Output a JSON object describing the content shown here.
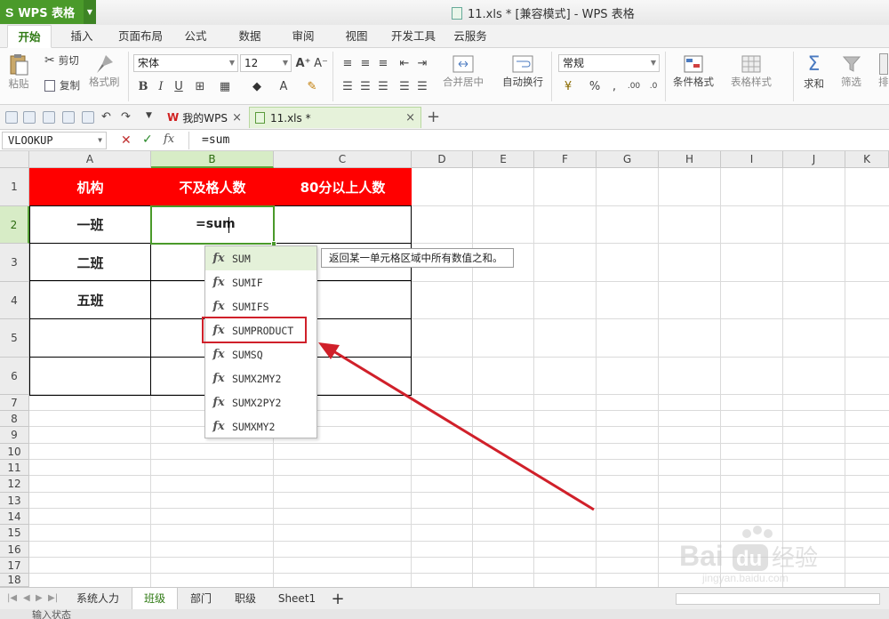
{
  "app": {
    "name": "WPS 表格",
    "window_title": "11.xls * [兼容模式] - WPS 表格"
  },
  "ribbon_tabs": [
    "开始",
    "插入",
    "页面布局",
    "公式",
    "数据",
    "审阅",
    "视图",
    "开发工具",
    "云服务"
  ],
  "ribbon": {
    "paste": "粘贴",
    "cut": "剪切",
    "copy": "复制",
    "format_painter": "格式刷",
    "font_name": "宋体",
    "font_size": "12",
    "bold": "B",
    "italic": "I",
    "underline": "U",
    "merge_center": "合并居中",
    "wrap_text": "自动换行",
    "number_format": "常规",
    "percent": "%",
    "cond_format": "条件格式",
    "table_style": "表格样式",
    "sum": "求和",
    "filter": "筛选",
    "sort": "排"
  },
  "doc_tabs": [
    {
      "label": "我的WPS",
      "active": false
    },
    {
      "label": "11.xls *",
      "active": true
    }
  ],
  "formula_bar": {
    "name_box": "VLOOKUP",
    "fx": "fx",
    "content": "=sum"
  },
  "columns": [
    "A",
    "B",
    "C",
    "D",
    "E",
    "F",
    "G",
    "H",
    "I",
    "J",
    "K"
  ],
  "rows": [
    "1",
    "2",
    "3",
    "4",
    "5",
    "6",
    "7",
    "8",
    "9",
    "10",
    "11",
    "12",
    "13",
    "14",
    "15",
    "16",
    "17",
    "18"
  ],
  "table": {
    "headers": [
      "机构",
      "不及格人数",
      "80分以上人数"
    ],
    "col_a": [
      "一班",
      "二班",
      "五班",
      "",
      ""
    ]
  },
  "editing_cell": {
    "ref": "B2",
    "text": "=sum"
  },
  "autocomplete": {
    "items": [
      "SUM",
      "SUMIF",
      "SUMIFS",
      "SUMPRODUCT",
      "SUMSQ",
      "SUMX2MY2",
      "SUMX2PY2",
      "SUMXMY2"
    ],
    "selected": "SUM",
    "boxed": "SUMPRODUCT",
    "tooltip": "返回某一单元格区域中所有数值之和。"
  },
  "sheet_tabs": [
    "系统人力",
    "班级",
    "部门",
    "职级",
    "Sheet1"
  ],
  "active_sheet": "班级",
  "status": "输入状态",
  "watermark": {
    "logo": "Baidu 经验",
    "url": "jingyan.baidu.com"
  },
  "colors": {
    "accent": "#4a9a2a",
    "header_fill": "#ff0000",
    "annotation": "#d0202a"
  }
}
